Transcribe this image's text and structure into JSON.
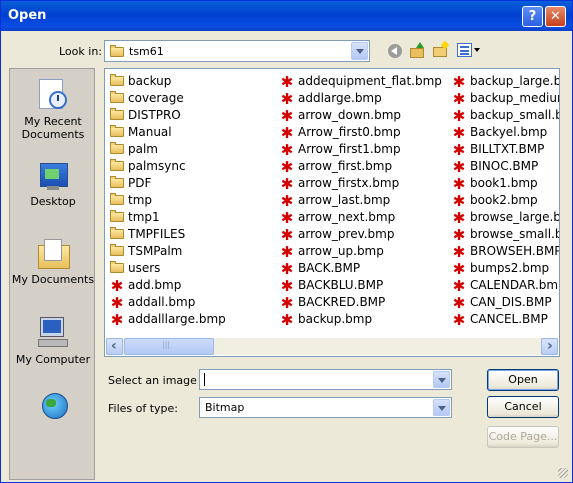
{
  "window": {
    "title": "Open",
    "help_glyph": "?",
    "close_glyph": "✕"
  },
  "toolbar": {
    "look_in_label": "Look in:",
    "look_in_value": "tsm61",
    "icons": [
      "back-icon",
      "up-folder-icon",
      "new-folder-icon",
      "views-menu-icon"
    ]
  },
  "places": [
    {
      "label": "My Recent Documents",
      "icon": "recent-documents-icon"
    },
    {
      "label": "Desktop",
      "icon": "desktop-icon"
    },
    {
      "label": "My Documents",
      "icon": "my-documents-icon"
    },
    {
      "label": "My Computer",
      "icon": "my-computer-icon"
    },
    {
      "label": "",
      "icon": "network-icon"
    }
  ],
  "files": {
    "col1": [
      {
        "name": "backup",
        "type": "folder"
      },
      {
        "name": "coverage",
        "type": "folder"
      },
      {
        "name": "DISTPRO",
        "type": "folder"
      },
      {
        "name": "Manual",
        "type": "folder"
      },
      {
        "name": "palm",
        "type": "folder"
      },
      {
        "name": "palmsync",
        "type": "folder"
      },
      {
        "name": "PDF",
        "type": "folder"
      },
      {
        "name": "tmp",
        "type": "folder"
      },
      {
        "name": "tmp1",
        "type": "folder"
      },
      {
        "name": "TMPFILES",
        "type": "folder"
      },
      {
        "name": "TSMPalm",
        "type": "folder"
      },
      {
        "name": "users",
        "type": "folder"
      },
      {
        "name": "add.bmp",
        "type": "bmp"
      },
      {
        "name": "addall.bmp",
        "type": "bmp"
      },
      {
        "name": "addalllarge.bmp",
        "type": "bmp"
      }
    ],
    "col2": [
      {
        "name": "addequipment_flat.bmp",
        "type": "bmp"
      },
      {
        "name": "addlarge.bmp",
        "type": "bmp"
      },
      {
        "name": "arrow_down.bmp",
        "type": "bmp"
      },
      {
        "name": "Arrow_first0.bmp",
        "type": "bmp"
      },
      {
        "name": "Arrow_first1.bmp",
        "type": "bmp"
      },
      {
        "name": "arrow_first.bmp",
        "type": "bmp"
      },
      {
        "name": "arrow_firstx.bmp",
        "type": "bmp"
      },
      {
        "name": "arrow_last.bmp",
        "type": "bmp"
      },
      {
        "name": "arrow_next.bmp",
        "type": "bmp"
      },
      {
        "name": "arrow_prev.bmp",
        "type": "bmp"
      },
      {
        "name": "arrow_up.bmp",
        "type": "bmp"
      },
      {
        "name": "BACK.BMP",
        "type": "bmp"
      },
      {
        "name": "BACKBLU.BMP",
        "type": "bmp"
      },
      {
        "name": "BACKRED.BMP",
        "type": "bmp"
      },
      {
        "name": "backup.bmp",
        "type": "bmp"
      }
    ],
    "col3": [
      {
        "name": "backup_large.bmp",
        "type": "bmp"
      },
      {
        "name": "backup_medium",
        "type": "bmp"
      },
      {
        "name": "backup_small.bmp",
        "type": "bmp"
      },
      {
        "name": "Backyel.bmp",
        "type": "bmp"
      },
      {
        "name": "BILLTXT.BMP",
        "type": "bmp"
      },
      {
        "name": "BINOC.BMP",
        "type": "bmp"
      },
      {
        "name": "book1.bmp",
        "type": "bmp"
      },
      {
        "name": "book2.bmp",
        "type": "bmp"
      },
      {
        "name": "browse_large.bmp",
        "type": "bmp"
      },
      {
        "name": "browse_small.bmp",
        "type": "bmp"
      },
      {
        "name": "BROWSEH.BMP",
        "type": "bmp"
      },
      {
        "name": "bumps2.bmp",
        "type": "bmp"
      },
      {
        "name": "CALENDAR.bmp",
        "type": "bmp"
      },
      {
        "name": "CAN_DIS.BMP",
        "type": "bmp"
      },
      {
        "name": "CANCEL.BMP",
        "type": "bmp"
      }
    ]
  },
  "scroll": {
    "left_glyph": "‹",
    "right_glyph": "›",
    "thumb_grip": "|||"
  },
  "form": {
    "select_label": "Select an image",
    "select_value": "",
    "filetype_label": "Files of type:",
    "filetype_value": "Bitmap"
  },
  "buttons": {
    "open": "Open",
    "cancel": "Cancel",
    "code_page": "Code Page..."
  }
}
